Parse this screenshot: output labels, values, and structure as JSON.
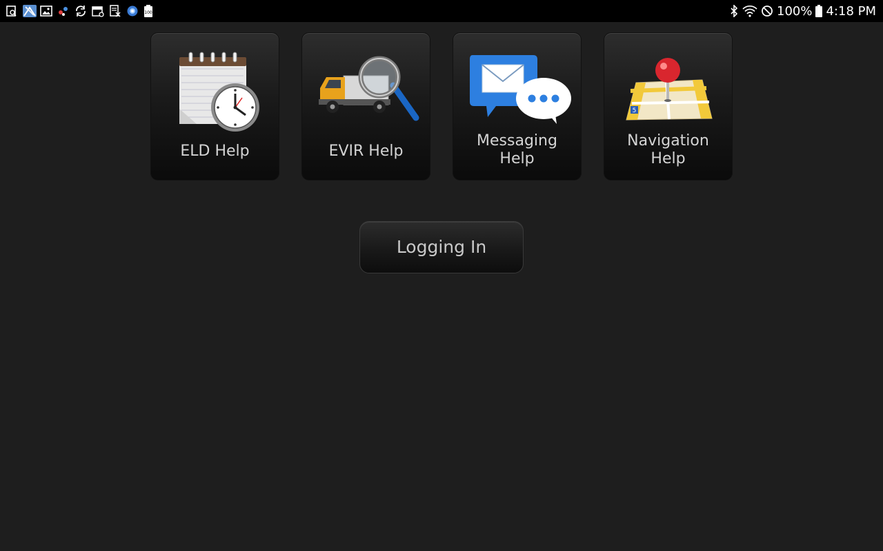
{
  "status_bar": {
    "notification_icons": [
      "viewer-icon",
      "map-icon",
      "gallery-icon",
      "share-icon",
      "sync-icon",
      "calendar-icon",
      "document-icon",
      "browser-icon",
      "battery-100-icon"
    ],
    "battery_text": "100%",
    "time": "4:18 PM"
  },
  "tiles": [
    {
      "label": "ELD Help",
      "icon": "eld-clock-notepad-icon"
    },
    {
      "label": "EVIR Help",
      "icon": "truck-magnifier-icon"
    },
    {
      "label": "Messaging\nHelp",
      "icon": "envelope-chat-icon"
    },
    {
      "label": "Navigation\nHelp",
      "icon": "map-pin-icon"
    }
  ],
  "login_button": {
    "label": "Logging In"
  },
  "colors": {
    "background": "#1e1e1e",
    "status_bar": "#000000",
    "tile_text": "#d4d4d4"
  }
}
